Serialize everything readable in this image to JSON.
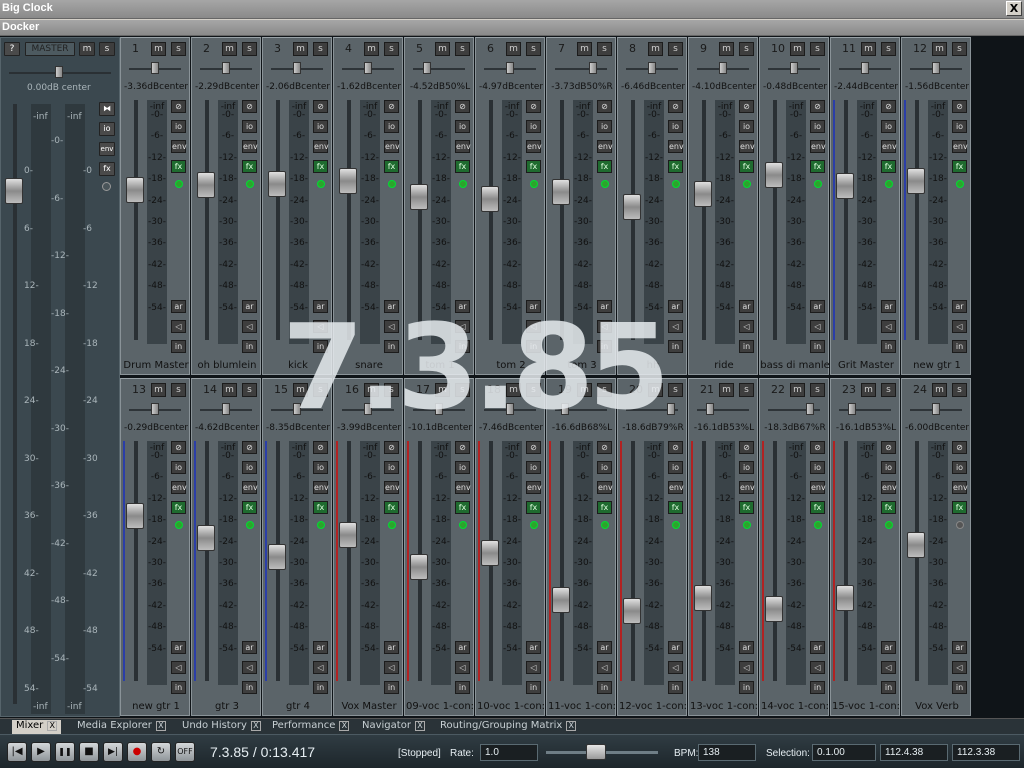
{
  "windows": {
    "big_clock_title": "Big Clock",
    "docker_title": "Docker",
    "close_glyph": "X"
  },
  "overlay": {
    "time": "7.3.85"
  },
  "master": {
    "help": "?",
    "label": "MASTER",
    "m": "m",
    "s": "s",
    "vol": "0.00dB center",
    "io": "io",
    "env": "env",
    "fx": "fx",
    "inf_left": "-inf",
    "inf_right": "-inf",
    "scale_left": [
      "0-",
      "6-",
      "12-",
      "18-",
      "24-",
      "30-",
      "36-",
      "42-",
      "48-",
      "54-"
    ],
    "scale_right": [
      "-0",
      "-6",
      "-12",
      "-18",
      "-24",
      "-30",
      "-36",
      "-42",
      "-48",
      "-54"
    ],
    "scale_mid": [
      "-0-",
      "-6-",
      "-12-",
      "-18-",
      "-24-",
      "-30-",
      "-36-",
      "-42-",
      "-48-",
      "-54-"
    ],
    "bottom_left": "-inf",
    "bottom_right": "-inf",
    "fader_db": 0
  },
  "meter_scale": [
    "-inf",
    "-0-",
    "-6-",
    "-12-",
    "-18-",
    "-24-",
    "-30-",
    "-36-",
    "-42-",
    "-48-",
    "-54-"
  ],
  "buttons": {
    "m": "m",
    "s": "s",
    "io": "io",
    "env": "env",
    "fx": "fx",
    "ar": "ar",
    "phase": "◁",
    "in": "in"
  },
  "tracks": [
    {
      "n": "1",
      "vol": "-3.36dBcenter",
      "name": "Drum Master",
      "fader_db": -3.36,
      "pan": 0,
      "fx_on": true
    },
    {
      "n": "2",
      "vol": "-2.29dBcenter",
      "name": "oh blumlein",
      "fader_db": -2.29,
      "pan": 0,
      "fx_on": true
    },
    {
      "n": "3",
      "vol": "-2.06dBcenter",
      "name": "kick",
      "fader_db": -2.06,
      "pan": 0,
      "fx_on": true
    },
    {
      "n": "4",
      "vol": "-1.62dBcenter",
      "name": "snare",
      "fader_db": -1.62,
      "pan": 0,
      "fx_on": true
    },
    {
      "n": "5",
      "vol": "-4.52dB50%L",
      "name": "tom 1",
      "fader_db": -4.52,
      "pan": -0.5,
      "fx_on": true
    },
    {
      "n": "6",
      "vol": "-4.97dBcenter",
      "name": "tom 2",
      "fader_db": -4.97,
      "pan": 0,
      "fx_on": true
    },
    {
      "n": "7",
      "vol": "-3.73dB50%R",
      "name": "tom 3",
      "fader_db": -3.73,
      "pan": 0.5,
      "fx_on": true
    },
    {
      "n": "8",
      "vol": "-6.46dBcenter",
      "name": "hh",
      "fader_db": -6.46,
      "pan": 0,
      "fx_on": true
    },
    {
      "n": "9",
      "vol": "-4.10dBcenter",
      "name": "ride",
      "fader_db": -4.1,
      "pan": 0,
      "fx_on": true
    },
    {
      "n": "10",
      "vol": "-0.48dBcenter",
      "name": "bass di manle",
      "fader_db": -0.48,
      "pan": 0,
      "fx_on": true
    },
    {
      "n": "11",
      "vol": "-2.44dBcenter",
      "name": "Grit Master",
      "fader_db": -2.44,
      "pan": 0,
      "fx_on": true
    },
    {
      "n": "12",
      "vol": "-1.56dBcenter",
      "name": "new gtr 1",
      "fader_db": -1.56,
      "pan": 0,
      "fx_on": true
    },
    {
      "n": "13",
      "vol": "-0.29dBcenter",
      "name": "new gtr 1",
      "fader_db": -0.29,
      "pan": 0,
      "fx_on": true
    },
    {
      "n": "14",
      "vol": "-4.62dBcenter",
      "name": "gtr 3",
      "fader_db": -4.62,
      "pan": 0,
      "fx_on": true
    },
    {
      "n": "15",
      "vol": "-8.35dBcenter",
      "name": "gtr 4",
      "fader_db": -8.35,
      "pan": 0,
      "fx_on": true
    },
    {
      "n": "16",
      "vol": "-3.99dBcenter",
      "name": "Vox Master",
      "fader_db": -3.99,
      "pan": 0,
      "fx_on": true
    },
    {
      "n": "17",
      "vol": "-10.1dBcenter",
      "name": "09-voc 1-con:",
      "fader_db": -10.1,
      "pan": 0,
      "fx_on": true
    },
    {
      "n": "18",
      "vol": "-7.46dBcenter",
      "name": "10-voc 1-con:",
      "fader_db": -7.46,
      "pan": 0,
      "fx_on": true
    },
    {
      "n": "19",
      "vol": "-16.6dB68%L",
      "name": "11-voc 1-con:",
      "fader_db": -16.6,
      "pan": -0.68,
      "fx_on": true
    },
    {
      "n": "20",
      "vol": "-18.6dB79%R",
      "name": "12-voc 1-con:",
      "fader_db": -18.6,
      "pan": 0.79,
      "fx_on": true
    },
    {
      "n": "21",
      "vol": "-16.1dB53%L",
      "name": "13-voc 1-con:",
      "fader_db": -16.1,
      "pan": -0.53,
      "fx_on": true
    },
    {
      "n": "22",
      "vol": "-18.3dB67%R",
      "name": "14-voc 1-con:",
      "fader_db": -18.3,
      "pan": 0.67,
      "fx_on": true
    },
    {
      "n": "23",
      "vol": "-16.1dB53%L",
      "name": "15-voc 1-con:",
      "fader_db": -16.1,
      "pan": -0.53,
      "fx_on": true
    },
    {
      "n": "24",
      "vol": "-6.00dBcenter",
      "name": "Vox Verb",
      "fader_db": -6.0,
      "pan": 0,
      "fx_on": false
    }
  ],
  "tabs": [
    {
      "label": "Mixer",
      "active": true
    },
    {
      "label": "Media Explorer",
      "active": false
    },
    {
      "label": "Undo History",
      "active": false
    },
    {
      "label": "Performance",
      "active": false
    },
    {
      "label": "Navigator",
      "active": false
    },
    {
      "label": "Routing/Grouping Matrix",
      "active": false
    }
  ],
  "tab_close": "X",
  "transport": {
    "btn_rewind": "|◀",
    "btn_play": "▶",
    "btn_pause": "❚❚",
    "btn_stop": "■",
    "btn_end": "▶|",
    "btn_rec": "●",
    "btn_loop": "↻",
    "btn_off": "OFF",
    "position": "7.3.85 / 0:13.417",
    "status": "[Stopped]",
    "rate_label": "Rate:",
    "rate": "1.0",
    "bpm_label": "BPM:",
    "bpm": "138",
    "selection_label": "Selection:",
    "sel_start": "0.1.00",
    "sel_end": "112.4.38",
    "sel_len": "112.3.38"
  },
  "colors": {
    "bg": "#0f1418",
    "strip": "#5b6469",
    "accent_green": "#2da32d",
    "meter_blue": "#2b3ea8",
    "meter_red": "#b22222"
  }
}
